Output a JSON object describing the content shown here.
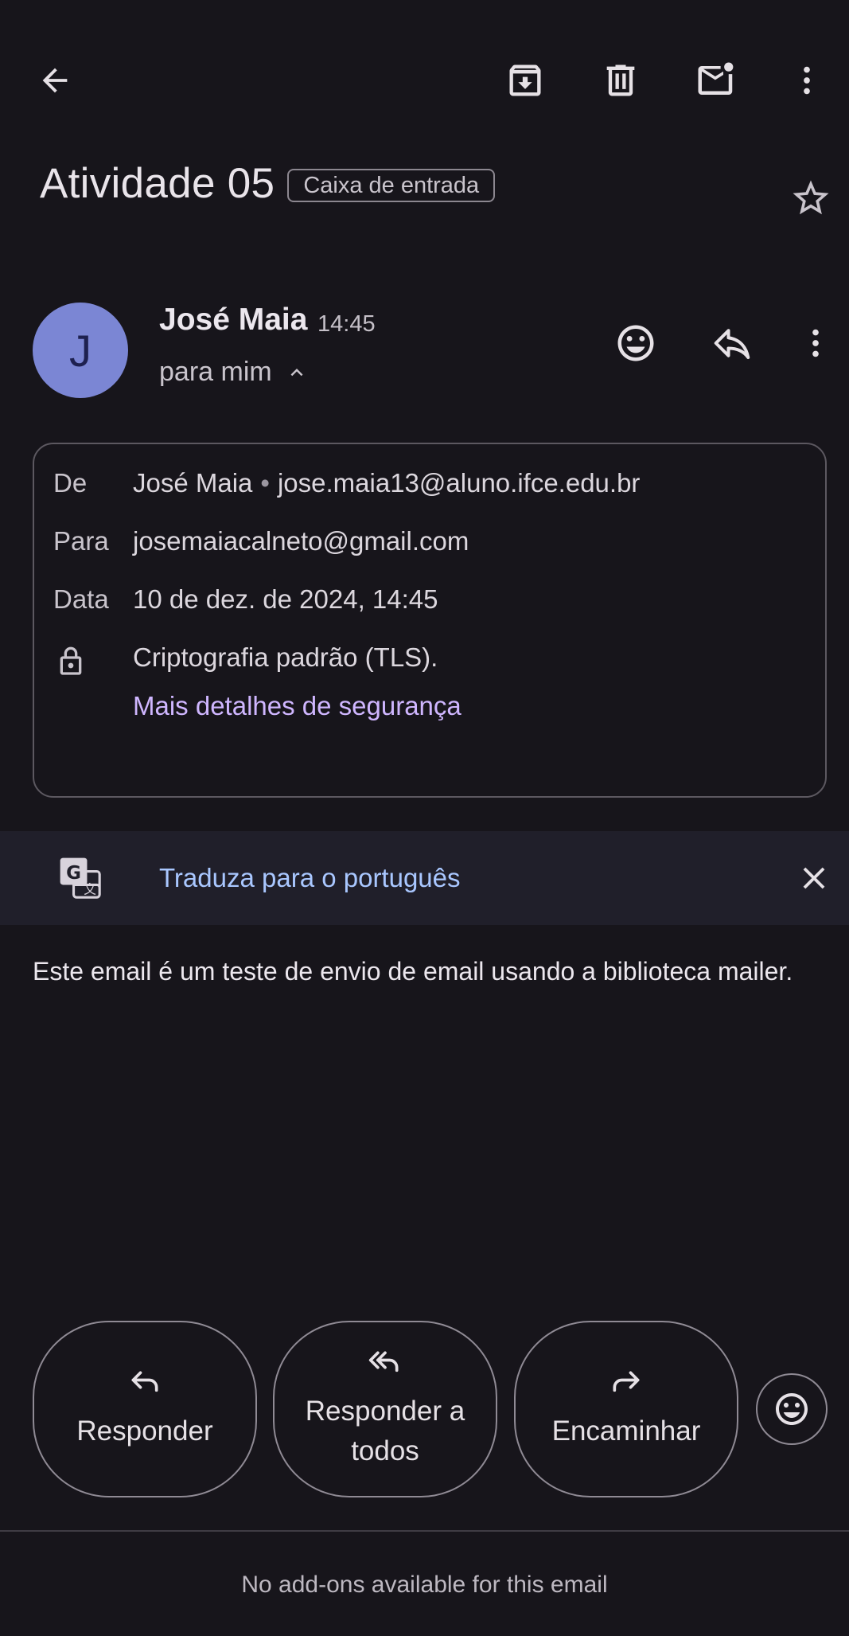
{
  "email": {
    "subject": "Atividade 05",
    "label": "Caixa de entrada",
    "sender": {
      "initial": "J",
      "name": "José Maia",
      "time": "14:45",
      "recipient_summary": "para mim"
    },
    "details": {
      "from_label": "De",
      "from_name": "José Maia",
      "separator": "•",
      "from_email": "jose.maia13@aluno.ifce.edu.br",
      "to_label": "Para",
      "to_email": "josemaiacalneto@gmail.com",
      "date_label": "Data",
      "date_value": "10 de dez. de 2024, 14:45",
      "encryption": "Criptografia padrão (TLS).",
      "security_link": "Mais detalhes de segurança"
    },
    "translate_banner": "Traduza para o português",
    "body": "Este email é um teste de envio de email usando a biblioteca mailer."
  },
  "actions": {
    "reply": "Responder",
    "reply_all": "Responder a todos",
    "forward": "Encaminhar"
  },
  "footer": {
    "addons_note": "No add-ons available for this email"
  },
  "icons": {
    "back": "arrow-back-icon",
    "archive": "archive-icon",
    "delete": "trash-icon",
    "mark_unread": "mark-unread-icon",
    "more": "more-vert-icon",
    "star": "star-icon",
    "emoji": "emoji-icon",
    "reply": "reply-icon",
    "reply_all": "reply-all-icon",
    "forward": "forward-icon",
    "lock": "lock-icon",
    "translate": "translate-icon",
    "close": "close-icon",
    "expand": "chevron-up-icon"
  },
  "colors": {
    "background": "#17151b",
    "avatar": "#7b86d4",
    "link": "#cfb6ff",
    "translate_link": "#a9c7ff",
    "banner": "#201f2a"
  }
}
